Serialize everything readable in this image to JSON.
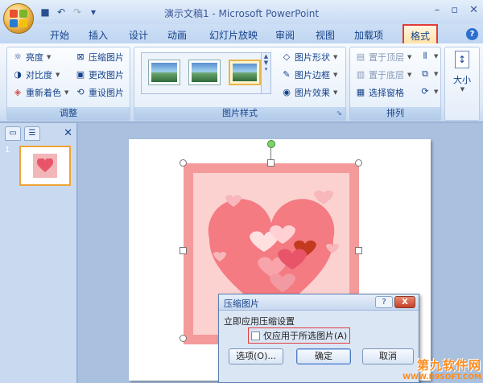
{
  "titlebar": {
    "title": "演示文稿1 - Microsoft PowerPoint",
    "qat_icons": [
      "save-icon",
      "undo-icon",
      "redo-icon",
      "customize-icon"
    ]
  },
  "tabs": [
    "开始",
    "插入",
    "设计",
    "动画",
    "幻灯片放映",
    "审阅",
    "视图",
    "加载项",
    "格式"
  ],
  "active_tab": "格式",
  "ribbon": {
    "adjust": {
      "label": "调整",
      "items": [
        {
          "label": "亮度",
          "icon": "sun-icon"
        },
        {
          "label": "对比度",
          "icon": "contrast-icon"
        },
        {
          "label": "重新着色",
          "icon": "recolor-icon"
        },
        {
          "label": "压缩图片",
          "icon": "compress-icon"
        },
        {
          "label": "更改图片",
          "icon": "change-picture-icon"
        },
        {
          "label": "重设图片",
          "icon": "reset-picture-icon"
        }
      ]
    },
    "styles": {
      "label": "图片样式",
      "items": [
        {
          "label": "图片形状",
          "icon": "shape-icon"
        },
        {
          "label": "图片边框",
          "icon": "border-icon"
        },
        {
          "label": "图片效果",
          "icon": "effects-icon"
        }
      ]
    },
    "arrange": {
      "label": "排列",
      "items": [
        {
          "label": "置于顶层",
          "icon": "bring-front-icon"
        },
        {
          "label": "置于底层",
          "icon": "send-back-icon"
        },
        {
          "label": "选择窗格",
          "icon": "selection-pane-icon"
        }
      ]
    },
    "size": {
      "label": "大小"
    }
  },
  "slides": {
    "num": "1"
  },
  "dialog": {
    "title": "压缩图片",
    "help": "?",
    "close": "X",
    "section": "立即应用压缩设置",
    "checkbox": "仅应用于所选图片(A)",
    "options": "选项(O)...",
    "ok": "确定",
    "cancel": "取消"
  },
  "watermark": {
    "main": "第九软件网",
    "sub": "WWW.D9SOFT.COM"
  }
}
